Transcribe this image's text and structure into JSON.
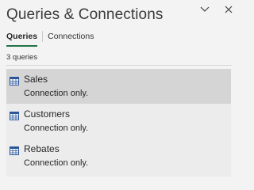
{
  "pane": {
    "title": "Queries & Connections",
    "minimize_icon": "chevron-down-icon",
    "close_icon": "close-icon"
  },
  "tabs": [
    {
      "label": "Queries",
      "active": true
    },
    {
      "label": "Connections",
      "active": false
    }
  ],
  "summary": {
    "count_label": "3 queries"
  },
  "queries": [
    {
      "name": "Sales",
      "status": "Connection only.",
      "icon": "table-icon",
      "selected": true
    },
    {
      "name": "Customers",
      "status": "Connection only.",
      "icon": "table-icon",
      "selected": false
    },
    {
      "name": "Rebates",
      "status": "Connection only.",
      "icon": "table-icon",
      "selected": false
    }
  ],
  "colors": {
    "accent": "#217346",
    "table_icon": "#2b579a"
  }
}
